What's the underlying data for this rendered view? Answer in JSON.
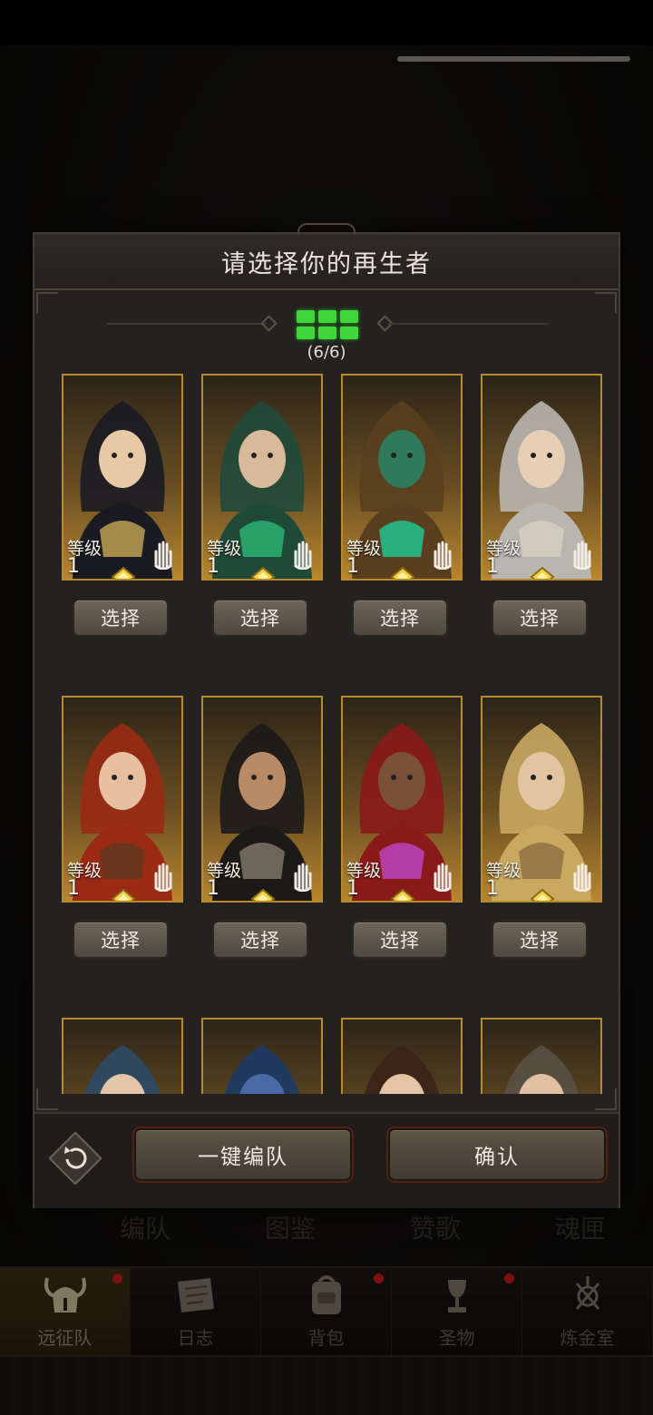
{
  "modal": {
    "title": "请选择你的再生者",
    "slot_count": "(6/6)",
    "select_label": "选择",
    "auto_team_label": "一键编队",
    "confirm_label": "确认"
  },
  "heroes": [
    {
      "level_label": "等级",
      "level": "1",
      "palette": "dark-hair"
    },
    {
      "level_label": "等级",
      "level": "1",
      "palette": "green-hood"
    },
    {
      "level_label": "等级",
      "level": "1",
      "palette": "jade-urn"
    },
    {
      "level_label": "等级",
      "level": "1",
      "palette": "silver-hair"
    },
    {
      "level_label": "等级",
      "level": "1",
      "palette": "red-hair"
    },
    {
      "level_label": "等级",
      "level": "1",
      "palette": "dark-warrior"
    },
    {
      "level_label": "等级",
      "level": "1",
      "palette": "crimson-armor"
    },
    {
      "level_label": "等级",
      "level": "1",
      "palette": "blonde-braid"
    },
    {
      "palette": "blue-hood"
    },
    {
      "palette": "blue-beast"
    },
    {
      "palette": "brown-hair"
    },
    {
      "palette": "horned-helm"
    }
  ],
  "background_tabs": [
    "编队",
    "图鉴",
    "赞歌",
    "魂匣"
  ],
  "bottom_nav": [
    {
      "label": "远征队",
      "icon": "horned-helmet-icon",
      "active": true
    },
    {
      "label": "日志",
      "icon": "scroll-icon"
    },
    {
      "label": "背包",
      "icon": "backpack-icon"
    },
    {
      "label": "圣物",
      "icon": "chalice-icon"
    },
    {
      "label": "炼金室",
      "icon": "alchemy-icon"
    }
  ],
  "colors": {
    "accent_gold": "#b98a2d",
    "slot_green": "#3ed63b",
    "badge_red": "#c01818"
  }
}
